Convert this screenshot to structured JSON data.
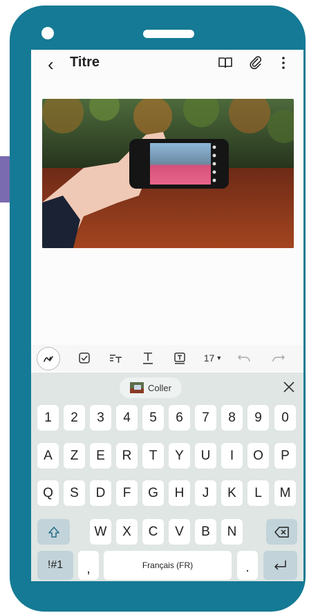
{
  "app": {
    "title": "Titre"
  },
  "toolbar": {
    "font_size": "17"
  },
  "keyboard": {
    "paste_label": "Coller",
    "row_numbers": [
      "1",
      "2",
      "3",
      "4",
      "5",
      "6",
      "7",
      "8",
      "9",
      "0"
    ],
    "row1": [
      "A",
      "Z",
      "E",
      "R",
      "T",
      "Y",
      "U",
      "I",
      "O",
      "P"
    ],
    "row2": [
      "Q",
      "S",
      "D",
      "F",
      "G",
      "H",
      "J",
      "K",
      "L",
      "M"
    ],
    "row3": [
      "W",
      "X",
      "C",
      "V",
      "B",
      "N"
    ],
    "symbols_label": "!#1",
    "comma": ",",
    "space_label": "Français (FR)",
    "period": "."
  }
}
